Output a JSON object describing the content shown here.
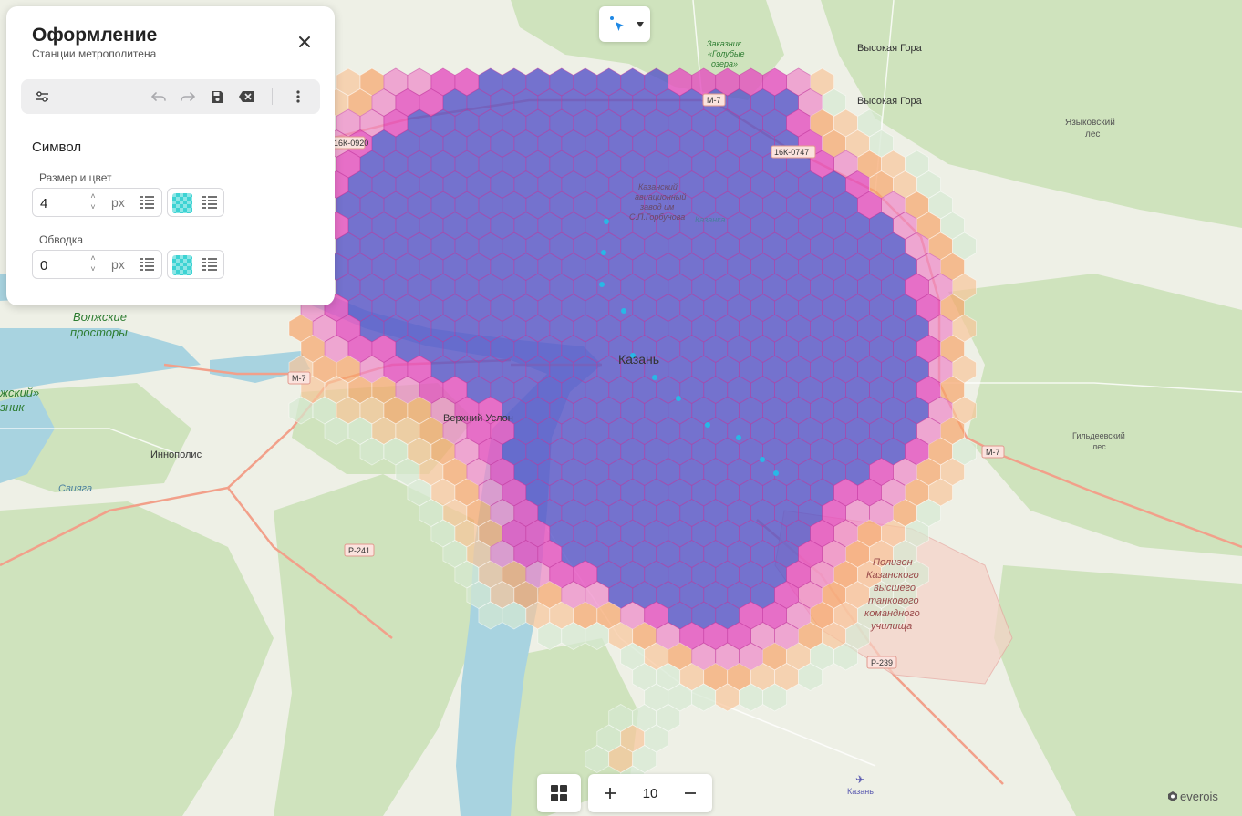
{
  "panel": {
    "title": "Оформление",
    "subtitle": "Станции метрополитена",
    "section_title": "Символ",
    "size": {
      "label": "Размер и цвет",
      "value": "4",
      "unit": "px"
    },
    "stroke": {
      "label": "Обводка",
      "value": "0",
      "unit": "px"
    },
    "swatch_color": "#30d2d2"
  },
  "toolbar": {
    "icons": [
      "sliders-icon",
      "undo-icon",
      "redo-icon",
      "save-icon",
      "clear-icon",
      "more-vert-icon"
    ]
  },
  "zoom": {
    "level": "10"
  },
  "logo": {
    "text": "everois"
  },
  "map": {
    "labels": {
      "kazan": "Казань",
      "vysokaya_gora_1": "Высокая Гора",
      "vysokaya_gora_2": "Высокая Гора",
      "yazykovsky_1": "Языковский",
      "yazykovsky_2": "лес",
      "zakaznik_1": "Заказник",
      "zakaznik_2": "«Голубые",
      "zakaznik_3": "озера»",
      "volzhskie_1": "Волжские",
      "volzhskie_2": "просторы",
      "zhsky_1": "жский»",
      "zhsky_2": "зник",
      "innopolis": "Иннополис",
      "verkhny_uslon": "Верхний Услон",
      "sviyaga": "Свияга",
      "gilderzeevsky_1": "Гильдеевский",
      "gilderzeevsky_2": "лес",
      "polygon_1": "Полигон",
      "polygon_2": "Казанского",
      "polygon_3": "высшего",
      "polygon_4": "танкового",
      "polygon_5": "командного",
      "polygon_6": "училища",
      "aviazavod_1": "Казанский",
      "aviazavod_2": "авиационный",
      "aviazavod_3": "завод им",
      "aviazavod_4": "С.П.Горбунова",
      "kazanka": "Казанка",
      "airport": "Казань"
    },
    "roads": {
      "m7_top": "М-7",
      "m7_left": "М-7",
      "m7_right": "М-7",
      "r16k0920": "16К-0920",
      "r16k0747": "16К-0747",
      "p241": "Р-241",
      "p239": "Р-239"
    },
    "hex_colors": {
      "level1": "#d6e8d2",
      "level2": "#f8c59a",
      "level3": "#f6a46a",
      "level4": "#ee86c8",
      "level5": "#e34fbf",
      "level6": "#5552c8"
    },
    "station_color": "#28b8e6"
  }
}
